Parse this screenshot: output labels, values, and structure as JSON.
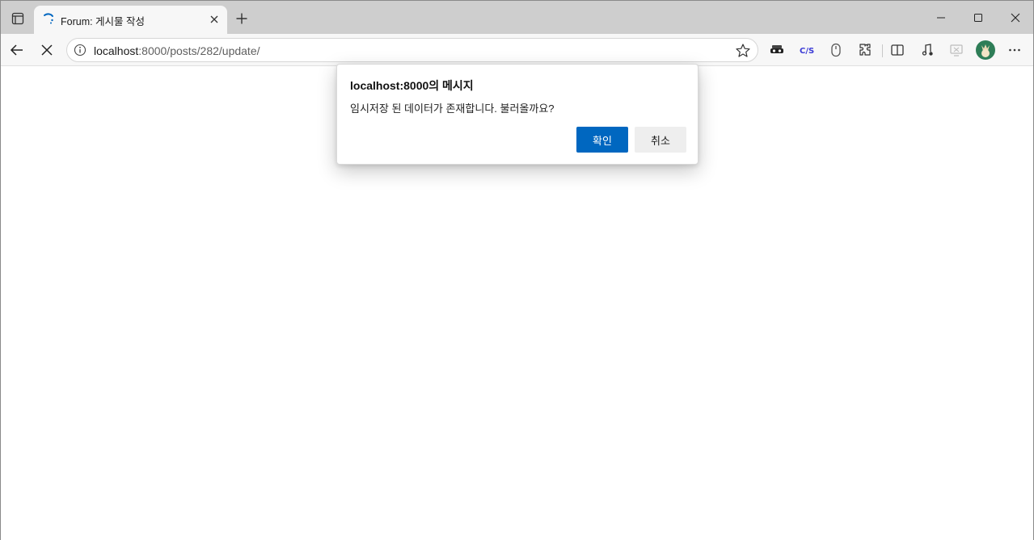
{
  "browser": {
    "tab": {
      "title": "Forum: 게시물 작성",
      "loading": true
    },
    "address_bar": {
      "url_host": "localhost",
      "url_path": ":8000/posts/282/update/"
    },
    "toolbar_icons": [
      "back-icon",
      "stop-icon",
      "info-icon",
      "favorite-star-icon",
      "extension-mask-icon",
      "extension-cjs-icon",
      "extension-mouse-icon",
      "extensions-icon",
      "split-screen-icon",
      "media-control-icon",
      "screenshot-icon",
      "profile-avatar",
      "more-icon"
    ],
    "window_controls": [
      "minimize-icon",
      "maximize-icon",
      "close-icon"
    ]
  },
  "dialog": {
    "title": "localhost:8000의 메시지",
    "message": "임시저장 된 데이터가 존재합니다. 불러올까요?",
    "ok_label": "확인",
    "cancel_label": "취소"
  },
  "colors": {
    "accent": "#0067c0",
    "tabbar": "#cecece",
    "toolbar": "#f7f7f7"
  }
}
